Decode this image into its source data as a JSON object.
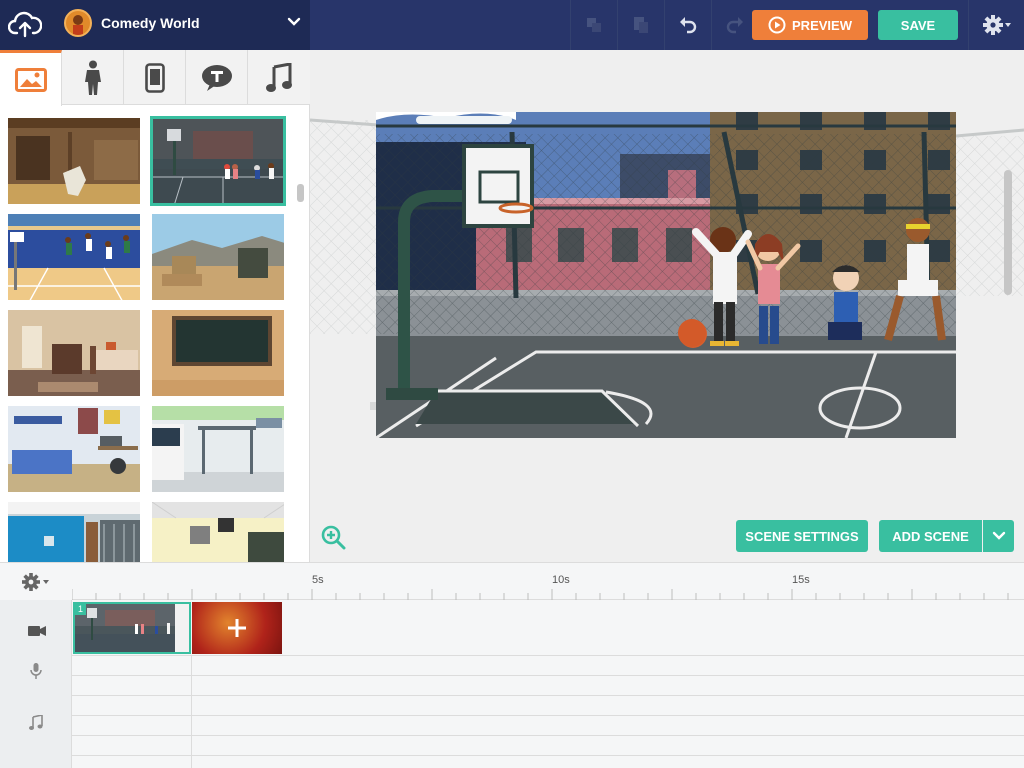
{
  "header": {
    "project_name": "Comedy World",
    "preview_label": "PREVIEW",
    "save_label": "SAVE",
    "icons": [
      "cloud-upload-icon",
      "copy-icon",
      "paste-icon",
      "undo-icon",
      "redo-icon",
      "play-circle-icon",
      "gear-icon"
    ]
  },
  "library": {
    "tabs": [
      {
        "name": "backgrounds",
        "icon": "image-icon",
        "active": true
      },
      {
        "name": "characters",
        "icon": "person-icon",
        "active": false
      },
      {
        "name": "props",
        "icon": "phone-icon",
        "active": false
      },
      {
        "name": "text",
        "icon": "speech-bubble-text-icon",
        "active": false
      },
      {
        "name": "audio",
        "icon": "music-note-icon",
        "active": false
      }
    ],
    "thumbnails": [
      "barn",
      "basketball-court",
      "gym",
      "desert-ruins",
      "bedroom",
      "chalkboard",
      "kids-bedroom",
      "bus-stop",
      "office",
      "classroom"
    ]
  },
  "stage": {
    "scene_settings_label": "SCENE SETTINGS",
    "add_scene_label": "ADD SCENE"
  },
  "timeline": {
    "ruler": [
      "5s",
      "10s",
      "15s"
    ],
    "tracks": [
      "video-camera-icon",
      "microphone-icon",
      "music-note-icon"
    ],
    "scene_number": "1",
    "add_clip_icon": "plus-icon"
  },
  "colors": {
    "topbar": "#28356a",
    "accent_orange": "#ef7f3a",
    "accent_teal": "#39bfa0"
  }
}
